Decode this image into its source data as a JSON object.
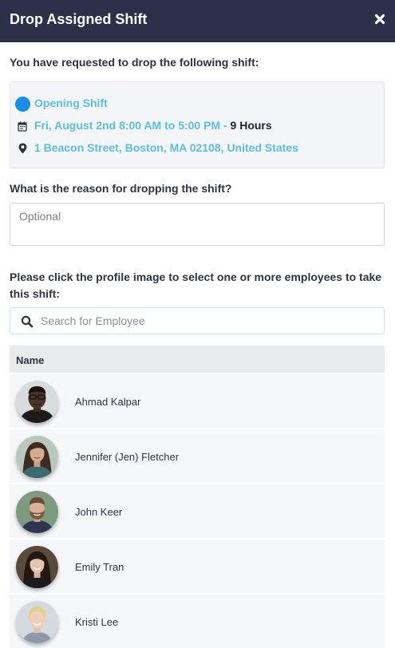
{
  "header": {
    "title": "Drop Assigned Shift",
    "close_icon": "close-icon"
  },
  "intro": "You have requested to drop the following shift:",
  "shift": {
    "name": "Opening Shift",
    "datetime": "Fri, August 2nd 8:00 AM to 5:00 PM -",
    "duration": "9 Hours",
    "location": "1 Beacon Street, Boston, MA 02108, United States",
    "color": "#1a8ee6",
    "accent": "#5bc0d8"
  },
  "reason": {
    "label": "What is the reason for dropping the shift?",
    "placeholder": "Optional",
    "value": ""
  },
  "select_label": "Please click the profile image to select one or more employees to take this shift:",
  "search": {
    "placeholder": "Search for Employee",
    "value": ""
  },
  "table": {
    "header": "Name",
    "employees": [
      {
        "name": "Ahmad Kalpar"
      },
      {
        "name": "Jennifer (Jen) Fletcher"
      },
      {
        "name": "John Keer"
      },
      {
        "name": "Emily Tran"
      },
      {
        "name": "Kristi Lee"
      }
    ]
  }
}
